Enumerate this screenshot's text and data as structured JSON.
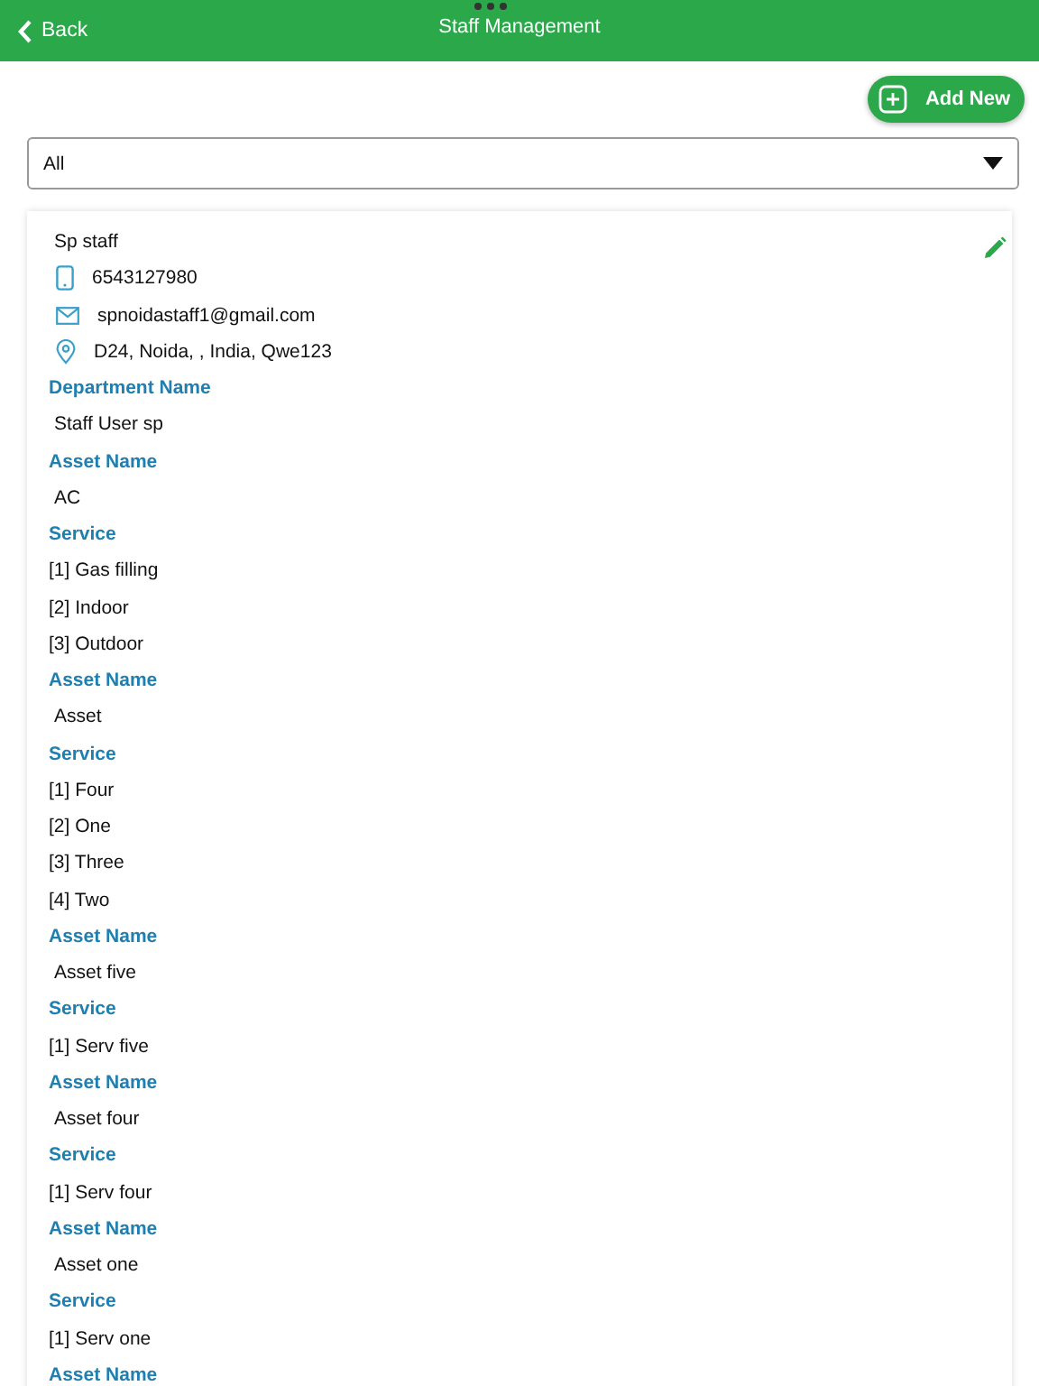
{
  "header": {
    "back": "Back",
    "title": "Staff Management"
  },
  "add_button": "Add New",
  "filter": {
    "value": "All"
  },
  "card": {
    "name": "Sp staff",
    "phone": "6543127980",
    "email": "spnoidastaff1@gmail.com",
    "address": "D24, Noida, , India, Qwe123",
    "lines": [
      {
        "kind": "heading",
        "text": "Department Name"
      },
      {
        "kind": "value",
        "text": "Staff User sp"
      },
      {
        "kind": "heading",
        "text": "Asset Name"
      },
      {
        "kind": "value",
        "text": "AC"
      },
      {
        "kind": "heading",
        "text": "Service"
      },
      {
        "kind": "service",
        "text": "[1] Gas filling"
      },
      {
        "kind": "service",
        "text": "[2] Indoor"
      },
      {
        "kind": "service",
        "text": "[3] Outdoor"
      },
      {
        "kind": "heading",
        "text": "Asset Name"
      },
      {
        "kind": "value",
        "text": "Asset"
      },
      {
        "kind": "heading",
        "text": "Service"
      },
      {
        "kind": "service",
        "text": "[1] Four"
      },
      {
        "kind": "service",
        "text": "[2] One"
      },
      {
        "kind": "service",
        "text": "[3] Three"
      },
      {
        "kind": "service",
        "text": "[4] Two"
      },
      {
        "kind": "heading",
        "text": "Asset Name"
      },
      {
        "kind": "value",
        "text": "Asset five"
      },
      {
        "kind": "heading",
        "text": "Service"
      },
      {
        "kind": "service",
        "text": "[1] Serv five"
      },
      {
        "kind": "heading",
        "text": "Asset Name"
      },
      {
        "kind": "value",
        "text": "Asset four"
      },
      {
        "kind": "heading",
        "text": "Service"
      },
      {
        "kind": "service",
        "text": "[1] Serv four"
      },
      {
        "kind": "heading",
        "text": "Asset Name"
      },
      {
        "kind": "value",
        "text": "Asset one"
      },
      {
        "kind": "heading",
        "text": "Service"
      },
      {
        "kind": "service",
        "text": "[1] Serv one"
      },
      {
        "kind": "heading",
        "text": "Asset Name"
      }
    ]
  }
}
